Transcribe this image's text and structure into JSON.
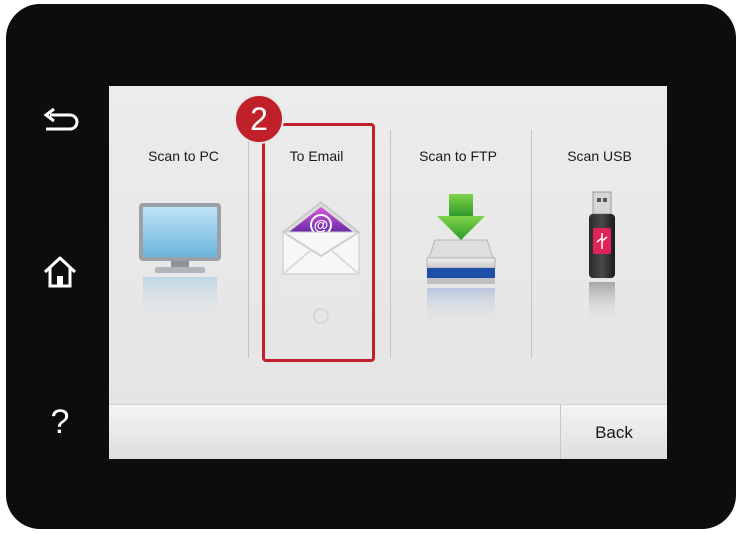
{
  "side_buttons": [
    {
      "name": "back-arrow-icon"
    },
    {
      "name": "home-icon"
    },
    {
      "name": "help-icon",
      "glyph": "?"
    }
  ],
  "tiles": [
    {
      "label": "Scan to PC",
      "icon": "monitor-icon"
    },
    {
      "label": "To Email",
      "icon": "email-envelope-icon"
    },
    {
      "label": "Scan to FTP",
      "icon": "ftp-drive-icon"
    },
    {
      "label": "Scan USB",
      "icon": "usb-drive-icon"
    }
  ],
  "bottom_bar": {
    "back_label": "Back"
  },
  "annotation": {
    "step_number": "2",
    "color": "#c0202a"
  }
}
